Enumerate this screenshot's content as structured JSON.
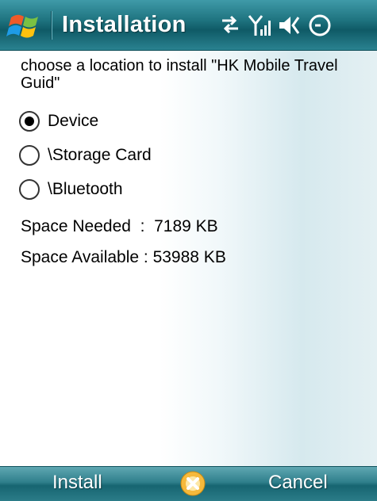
{
  "title_bar": {
    "title": "Installation",
    "icons": [
      "windows-start-icon",
      "connectivity-arrows-icon",
      "signal-strength-icon",
      "volume-icon",
      "clock-icon"
    ]
  },
  "dialog": {
    "prompt": "choose a location to install \"HK Mobile Travel Guid\"",
    "locations": [
      {
        "label": "Device",
        "selected": true
      },
      {
        "label": "\\Storage Card",
        "selected": false
      },
      {
        "label": "\\Bluetooth",
        "selected": false
      }
    ],
    "space_needed_label": "Space Needed  :  ",
    "space_needed_value": "7189 KB",
    "space_available_label": "Space Available : ",
    "space_available_value": "53988 KB"
  },
  "softkeys": {
    "left": "Install",
    "right": "Cancel",
    "center_icon": "close-x-icon"
  },
  "colors": {
    "title_bar": "#1f7480",
    "softkey_bar": "#2f7f8b",
    "text": "#000000"
  }
}
